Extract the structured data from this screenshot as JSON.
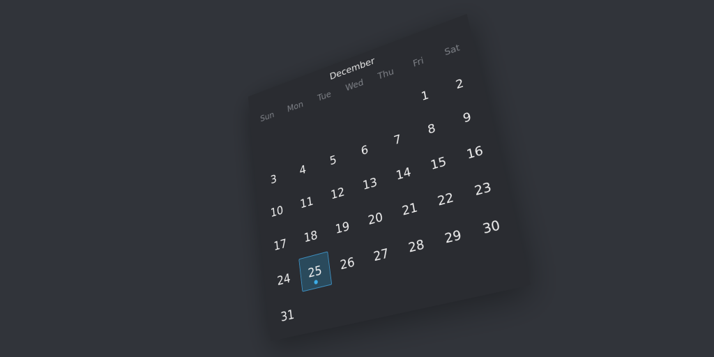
{
  "calendar": {
    "month": "December",
    "weekdays": [
      "Sun",
      "Mon",
      "Tue",
      "Wed",
      "Thu",
      "Fri",
      "Sat"
    ],
    "leading_blank_days": 5,
    "days_in_month": 31,
    "today": 25,
    "event_days": [
      25
    ],
    "colors": {
      "today_fill": "#2a4a5c",
      "today_border": "#3d8fc0",
      "event_dot": "#3daee9"
    }
  }
}
